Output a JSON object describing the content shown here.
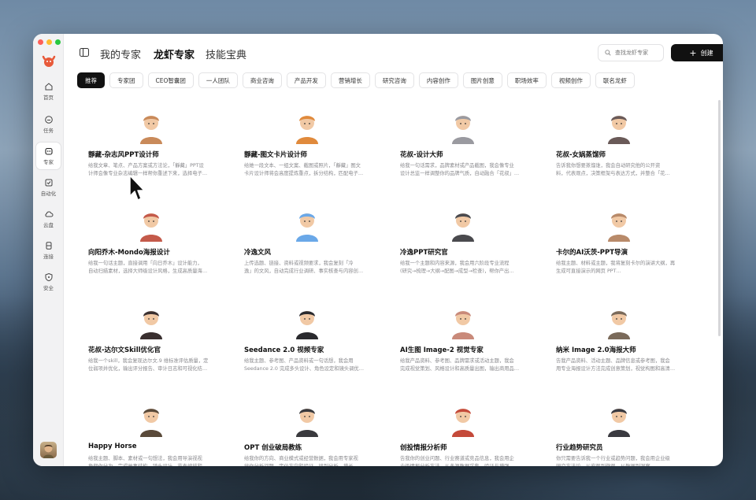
{
  "header": {
    "tabs": [
      {
        "label": "我的专家",
        "active": false
      },
      {
        "label": "龙虾专家",
        "active": true
      },
      {
        "label": "技能宝典",
        "active": false
      }
    ],
    "search_placeholder": "查找龙虾专家",
    "create_label": "创建"
  },
  "sidebar": {
    "items": [
      {
        "label": "首页",
        "icon": "home-icon"
      },
      {
        "label": "任务",
        "icon": "chat-icon"
      },
      {
        "label": "专家",
        "icon": "robot-icon",
        "active": true
      },
      {
        "label": "自动化",
        "icon": "check-square-icon"
      },
      {
        "label": "云盘",
        "icon": "cloud-icon"
      },
      {
        "label": "连接",
        "icon": "database-icon"
      },
      {
        "label": "安全",
        "icon": "shield-icon"
      }
    ]
  },
  "filters": [
    "推荐",
    "专家团",
    "CEO智囊团",
    "一人团队",
    "商业咨询",
    "产品开发",
    "营销增长",
    "研究咨询",
    "内容创作",
    "图片创意",
    "职场效率",
    "视频创作",
    "联名龙虾"
  ],
  "active_filter": "推荐",
  "cards": [
    {
      "name": "靜藏-杂志风PPT设计师",
      "desc1": "给我文章、笔点、产品方案或方法论，「靜藏」PPT设",
      "desc2": "计师会像专业杂志编辑一样帮你重述下来，选择电子…",
      "avatar_color": "#c98a5a"
    },
    {
      "name": "靜藏-图文卡片设计师",
      "desc1": "给她一段文本、一组文案、截图或照片，「靜藏」图文",
      "desc2": "卡片设计师将会高度提炼重点，拆分结构，匹配电子…",
      "avatar_color": "#e08a3c"
    },
    {
      "name": "花叔-设计大师",
      "desc1": "给我一句话需求，品牌素材或产品截图，我会像专业",
      "desc2": "设计总监一样调整你的品牌气质，自动融合「花叔」…",
      "avatar_color": "#9a9aa0"
    },
    {
      "name": "花叔-女娲蒸馏师",
      "desc1": "告诉我你想要蒸馏谁，我会自动研究他的公开资",
      "desc2": "料，代表观点，决策框架与表达方式，并整合「花…",
      "avatar_color": "#6a5a58"
    },
    {
      "name": "向阳乔木-Mondo海报设计",
      "desc1": "给我一句话主题，直接调用「向日乔木」设计能力，",
      "desc2": "自动扫描素材，选择大师级设计风格，生成高质量海…",
      "avatar_color": "#c45a4a"
    },
    {
      "name": "冷逸文风",
      "desc1": "上传选题、链接、资料或视频要求，我会复刻「冷",
      "desc2": "逸」的文风，自动完成行业调研、事实核查与内容创…",
      "avatar_color": "#6aa8e8"
    },
    {
      "name": "冷逸PPT研究官",
      "desc1": "给我一个主题和内容来源，我会用六阶段专业流程",
      "desc2": "(研究→梳理→大纲→配图→成型→检查)，帮你产出…",
      "avatar_color": "#4a4a4e"
    },
    {
      "name": "卡尔的AI沃茨-PPT导演",
      "desc1": "给我主题、材料或主题，我将复刻卡尔的演讲大纲，再",
      "desc2": "生成可直接演示的网页 PPT…",
      "avatar_color": "#b88a6a"
    },
    {
      "name": "花叔-达尔文Skill优化官",
      "desc1": "给我一个skill，我会复现达尔文.9 维标准评估质量，定",
      "desc2": "位弱项并优化，输出评分报告、审计日志和可视化结…",
      "avatar_color": "#3a3030"
    },
    {
      "name": "Seedance 2.0 视频专家",
      "desc1": "给我主题、参考图、产品资料或一句话想，我会用",
      "desc2": "Seedance 2.0 完成多头设计、角色设定和镜头调优…",
      "avatar_color": "#2a2a2e"
    },
    {
      "name": "AI生图 Image-2 视觉专家",
      "desc1": "给我产品资料、参考图、品牌需求或活动主题，我会",
      "desc2": "完成视觉策划、风格设计和高质量出图，输出商用品…",
      "avatar_color": "#c98a7a"
    },
    {
      "name": "纳米 Image 2.0海报大师",
      "desc1": "告我产品资料、活动主题、品牌信息或参考图，我会",
      "desc2": "用专业海报设计方法完成创意策划，视觉构图和高清…",
      "avatar_color": "#7a6a5a"
    },
    {
      "name": "Happy Horse",
      "desc1": "给我主题、脚本、素材或一句想法，我会用导演视视",
      "desc2": "角帮你分为，完成故事结构、镜头设计、节奏编排和…",
      "avatar_color": "#5a4a3a"
    },
    {
      "name": "OPT 创业破局教练",
      "desc1": "给我你的方向、商业模式或经营数据，我会用专家视",
      "desc2": "觉你分析问题、定位方向和验证、找到分析，增长…",
      "avatar_color": "#3a3a3e"
    },
    {
      "name": "创投情报分析师",
      "desc1": "告我你的创业问题、行业赛道或竞品信息，我会用企",
      "desc2": "业级情报分析方法，从多源数据采集、验证与增强…",
      "avatar_color": "#c44a3a"
    },
    {
      "name": "行业趋势研究员",
      "desc1": "你只需要告诉我一个行业或趋势问题，我会用企业级",
      "desc2": "研究方法论，从宏观到微观，从数据到洞察…",
      "avatar_color": "#3a3a40"
    }
  ]
}
